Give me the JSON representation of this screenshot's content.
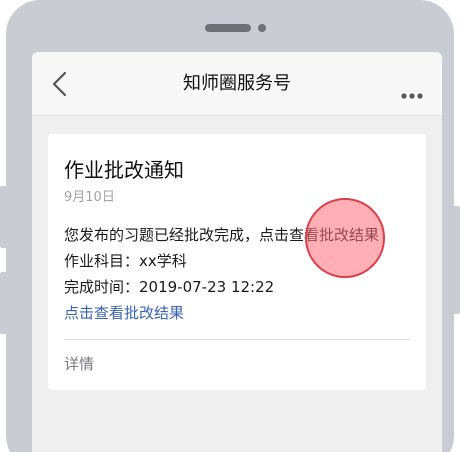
{
  "nav": {
    "title": "知师圈服务号",
    "back_icon": "chevron-left-icon",
    "more_icon": "more-dots-icon"
  },
  "card": {
    "title": "作业批改通知",
    "date": "9月10日",
    "message": "您发布的习题已经批改完成，点击查看批改结果",
    "subject": "作业科目：xx学科",
    "completed_time": "完成时间：2019-07-23 12:22",
    "link": "点击查看批改结果",
    "detail": "详情"
  },
  "colors": {
    "link": "#3a63b5",
    "tap_indicator": "#e03a47",
    "screen_bg": "#efeff0"
  }
}
